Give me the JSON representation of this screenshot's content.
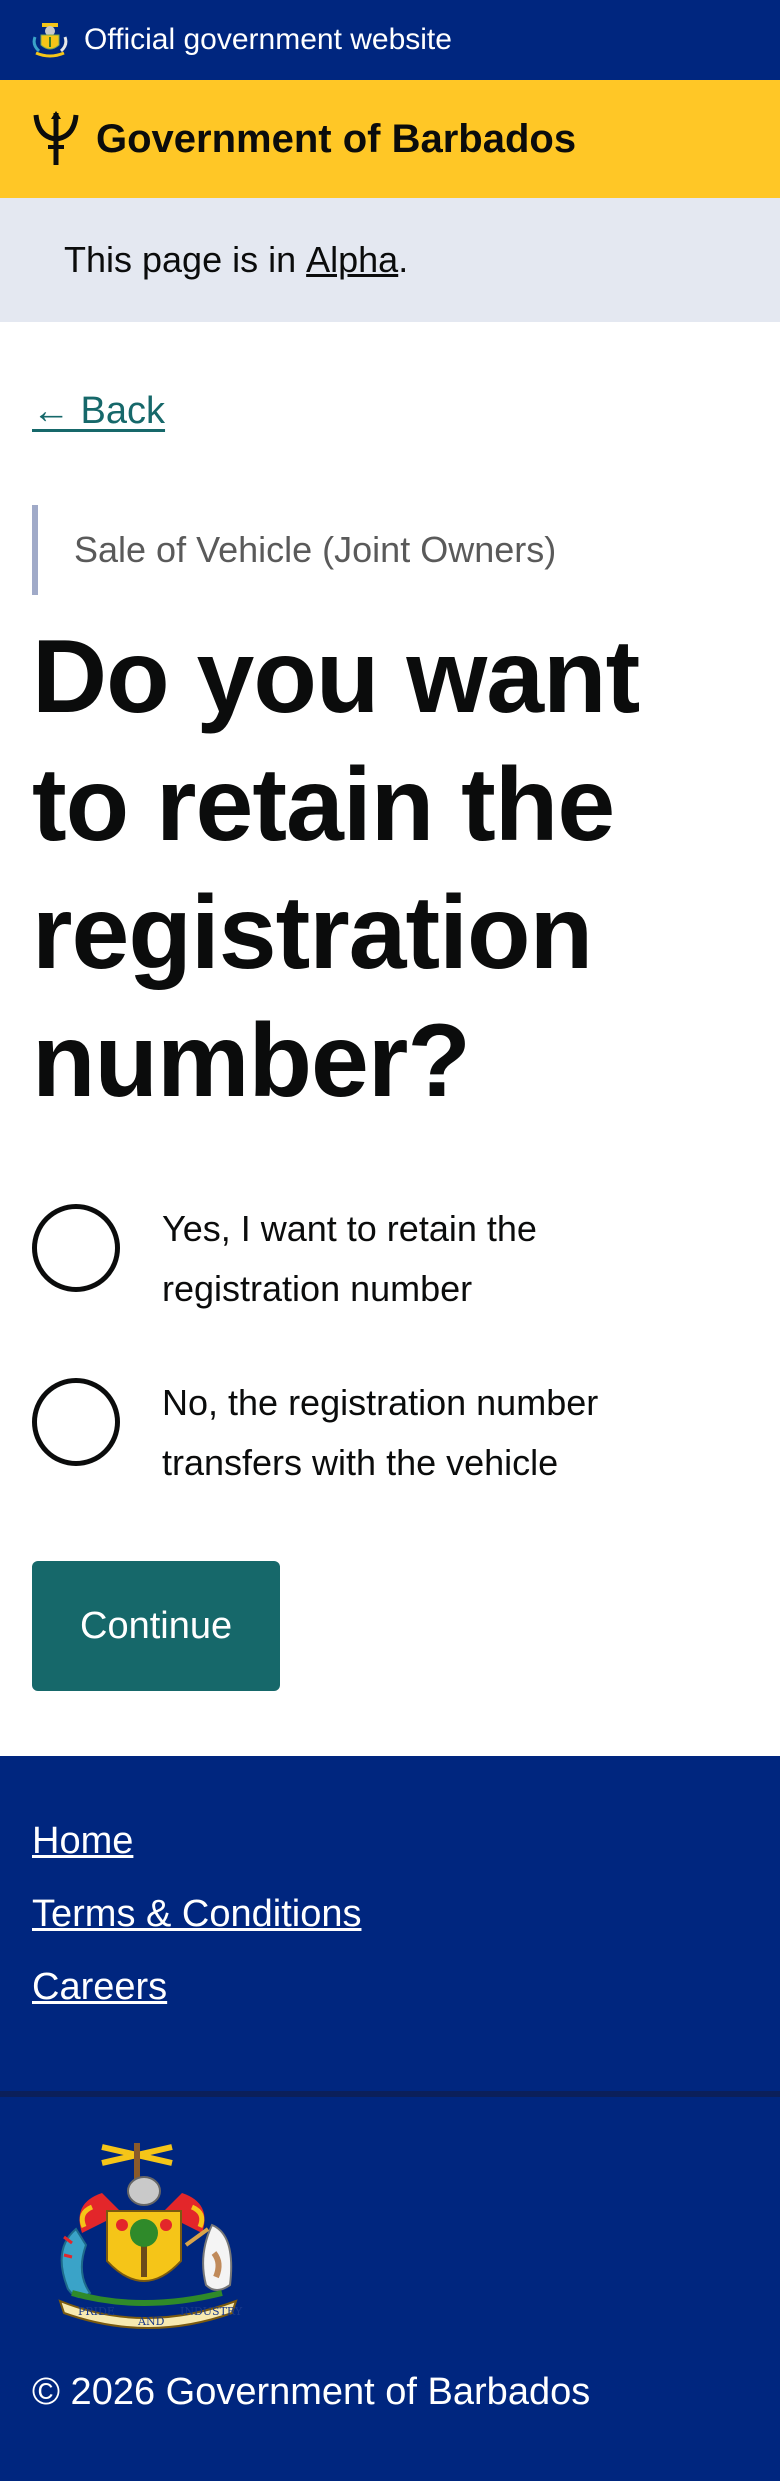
{
  "banner": {
    "text": "Official government website",
    "icon": "coat-of-arms-icon"
  },
  "header": {
    "title": "Government of Barbados",
    "icon": "trident-icon"
  },
  "phase": {
    "prefix": "This page is in ",
    "link": "Alpha",
    "suffix": "."
  },
  "back": {
    "label": "← Back"
  },
  "caption": "Sale of Vehicle (Joint Owners)",
  "question": "Do you want to retain the registration number?",
  "options": [
    {
      "label": "Yes, I want to retain the registration number",
      "checked": false
    },
    {
      "label": "No, the registration number transfers with the vehicle",
      "checked": false
    }
  ],
  "continue_label": "Continue",
  "footer": {
    "links": [
      "Home",
      "Terms & Conditions",
      "Careers"
    ],
    "copyright": "© 2026 Government of Barbados",
    "motto": [
      "PRIDE",
      "AND",
      "INDUSTRY"
    ]
  },
  "colors": {
    "navy": "#00267f",
    "yellow": "#ffc726",
    "teal": "#16686a",
    "phase_bg": "#e4e8f1"
  }
}
